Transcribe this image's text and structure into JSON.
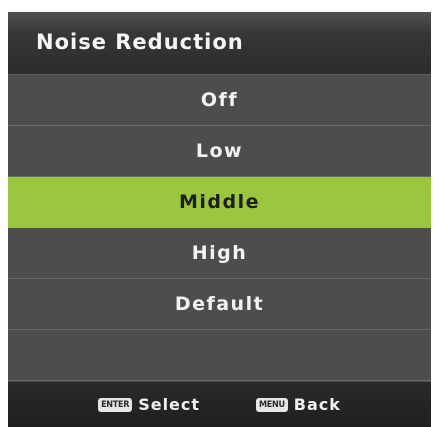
{
  "header": {
    "title": "Noise Reduction"
  },
  "menu": {
    "items": [
      {
        "label": "Off"
      },
      {
        "label": "Low"
      },
      {
        "label": "Middle",
        "selected": true
      },
      {
        "label": "High"
      },
      {
        "label": "Default"
      }
    ]
  },
  "footer": {
    "select_key": "ENTER",
    "select_label": "Select",
    "back_key": "MENU",
    "back_label": "Back"
  },
  "colors": {
    "selected_bg": "#9cc640",
    "panel_bg": "#4d4d4d",
    "header_bg": "#333333"
  }
}
